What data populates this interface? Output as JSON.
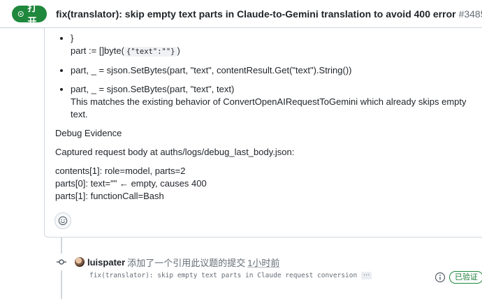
{
  "header": {
    "state": "打开",
    "title": "fix(translator): skip empty text parts in Claude-to-Gemini translation to avoid 400 error",
    "number": "#3485"
  },
  "comment": {
    "bullets": [
      {
        "line1": "}",
        "line2_prefix": "part := []byte(",
        "line2_code": "{\"text\":\"\"}",
        "line2_suffix": ")"
      },
      {
        "text": "part, _ = sjson.SetBytes(part, \"text\", contentResult.Get(\"text\").String())"
      },
      {
        "text": "part, _ = sjson.SetBytes(part, \"text\", text)",
        "text2": "This matches the existing behavior of ConvertOpenAIRequestToGemini which already skips empty text."
      }
    ],
    "debug_heading": "Debug Evidence",
    "captured": "Captured request body at auths/logs/debug_last_body.json:",
    "evidence_lines": [
      "contents[1]: role=model, parts=2",
      "parts[0]: text=\"\" ← empty, causes 400",
      "parts[1]: functionCall=Bash"
    ],
    "emoji_icon": "smiley-icon"
  },
  "timeline": {
    "author": "luispater",
    "action": "添加了一个引用此议题的提交",
    "time": "1小时前",
    "commit_message": "fix(translator): skip empty text parts in Claude request conversion",
    "ellipsis": "…",
    "verified": "已验证"
  },
  "colors": {
    "open_green": "#1f883d",
    "text_primary": "#1f2328",
    "text_muted": "#656d76",
    "border": "#d0d7de"
  }
}
